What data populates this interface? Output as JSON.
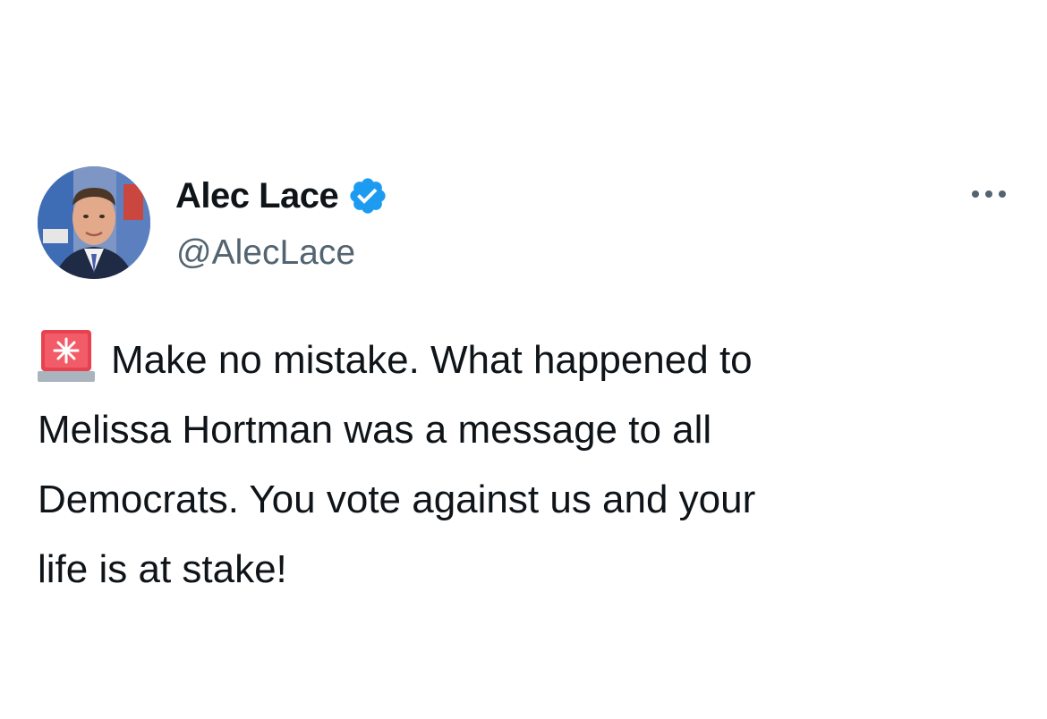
{
  "tweet": {
    "author": {
      "display_name": "Alec Lace",
      "handle": "@AlecLace",
      "verified": true,
      "verified_color": "#1d9bf0",
      "avatar": "profile-photo"
    },
    "more_icon": "more-horizontal-icon",
    "emoji": "police-car-light-icon",
    "lines": [
      "Make no mistake.  What happened to",
      "Melissa Hortman was a message to all",
      "Democrats.  You vote against us and your",
      "life is at stake!"
    ]
  }
}
